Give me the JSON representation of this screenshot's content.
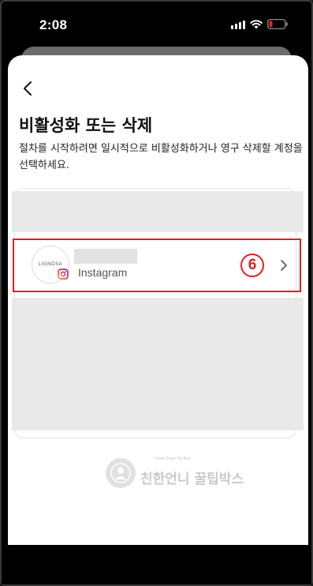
{
  "status_bar": {
    "time": "2:08",
    "icons": [
      "signal-icon",
      "wifi-icon",
      "battery-low-icon"
    ],
    "battery_color": "#e0262b"
  },
  "header": {
    "back_icon": "chevron-left-icon"
  },
  "page": {
    "title": "비활성화 또는 삭제",
    "description": "절차를 시작하려면 일시적으로 비활성화하거나 영구 삭제할 계정을 선택하세요."
  },
  "account": {
    "avatar_text": "LIGNOSA",
    "platform_icon": "instagram-icon",
    "platform": "Instagram",
    "chevron_icon": "chevron-right-icon"
  },
  "annotation": {
    "step_label": "6",
    "highlight_color": "#e02020"
  },
  "watermark": {
    "small_text": "Close Sister Tip Box",
    "text": "친한언니 꿀팁박스"
  }
}
